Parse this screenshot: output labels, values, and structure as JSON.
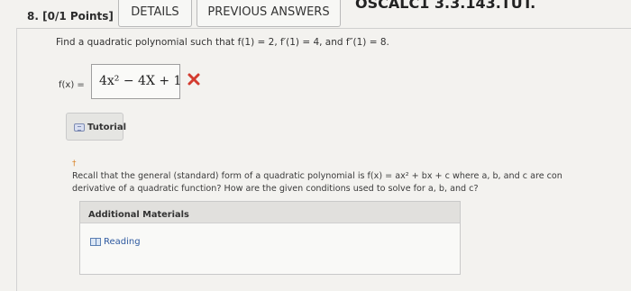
{
  "question": {
    "number_label": "8.",
    "points_label": "[0/1 Points]",
    "tabs": [
      "DETAILS",
      "PREVIOUS ANSWERS"
    ],
    "code": "OSCALC1 3.3.143.TUT."
  },
  "prompt": {
    "text": "Find a quadratic polynomial such that f(1) = 2, f′(1) = 4, and f″(1) = 8."
  },
  "answer": {
    "label": "f(x) =",
    "value": "4x² − 4X + 1",
    "status": "incorrect",
    "status_color": "#d33b2f"
  },
  "tutorial": {
    "label": "Tutorial",
    "icon": "tutorial-icon"
  },
  "hint": {
    "marker": "†",
    "line1": "Recall that the general (standard) form of a quadratic polynomial is f(x) = ax² + bx + c where a, b, and c are con",
    "line2": "derivative of a quadratic function? How are the given conditions used to solve for a, b, and c?"
  },
  "additional_materials": {
    "title": "Additional Materials",
    "items": [
      {
        "label": "Reading",
        "icon": "book-icon"
      }
    ]
  },
  "colors": {
    "background": "#f3f2ef",
    "panel_header": "#e1e0dd",
    "link": "#2f5aa0",
    "dagger": "#d98022"
  }
}
